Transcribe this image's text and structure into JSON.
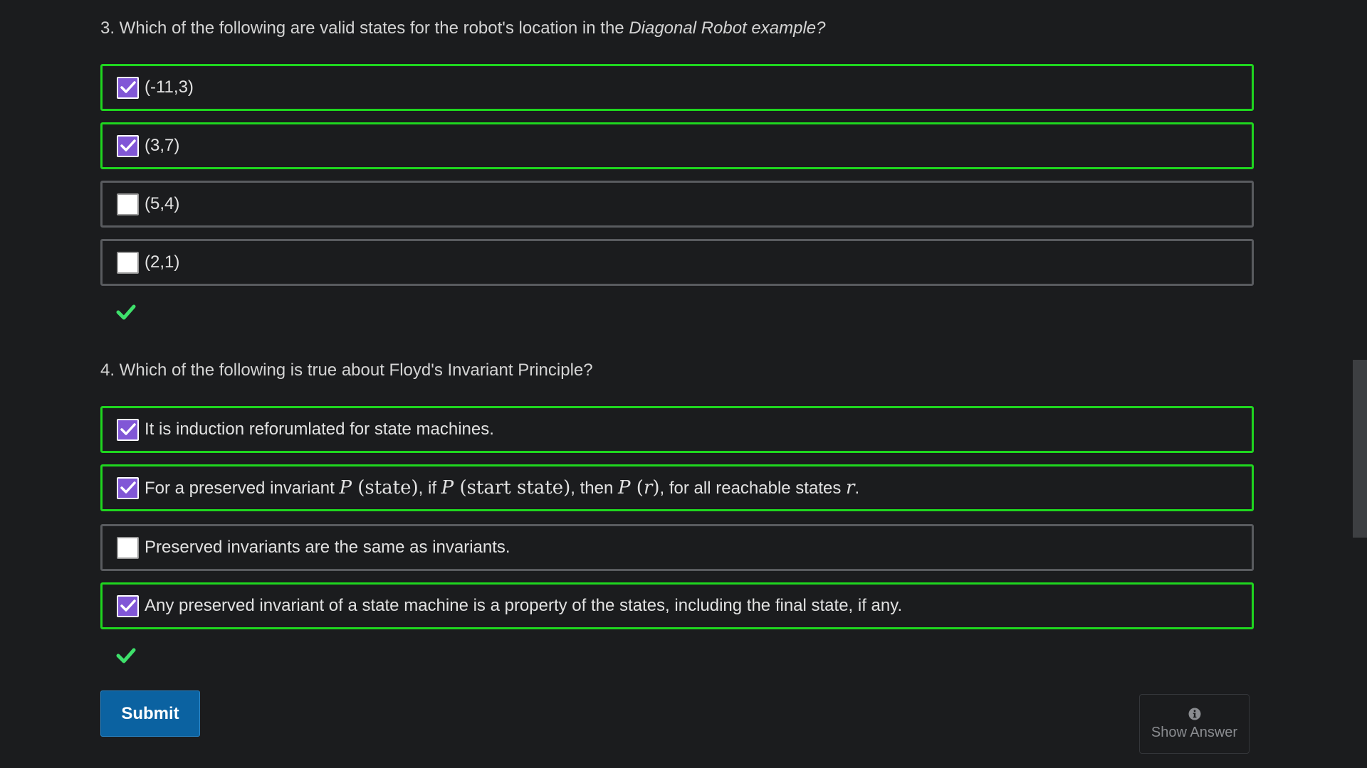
{
  "questions": [
    {
      "number_text": "3. Which of the following are valid states for the robot's location in the ",
      "italic_text": "Diagonal Robot example?",
      "options": [
        {
          "label": "(-11,3)",
          "checked": true,
          "correct": true
        },
        {
          "label": "(3,7)",
          "checked": true,
          "correct": true
        },
        {
          "label": "(5,4)",
          "checked": false,
          "correct": false
        },
        {
          "label": "(2,1)",
          "checked": false,
          "correct": false
        }
      ],
      "result": "correct"
    },
    {
      "number_text": "4. Which of the following is true about Floyd's Invariant Principle?",
      "options": [
        {
          "label": "It is induction reforumlated for state machines.",
          "checked": true,
          "correct": true
        },
        {
          "label_parts": {
            "t1": "For a preserved invariant ",
            "m1_var": "P",
            "m1_arg": "(state)",
            "t2": ", if ",
            "m2_var": "P",
            "m2_arg": "(start state)",
            "t3": ", then ",
            "m3_var": "P",
            "m3_arg_open": "(",
            "m3_arg_var": "r",
            "m3_arg_close": ")",
            "t4": ", for all reachable states ",
            "m4_var": "r",
            "t5": "."
          },
          "checked": true,
          "correct": true
        },
        {
          "label": "Preserved invariants are the same as invariants.",
          "checked": false,
          "correct": false
        },
        {
          "label": "Any preserved invariant of a state machine is a property of the states, including the final state, if any.",
          "checked": true,
          "correct": true
        }
      ],
      "result": "correct"
    }
  ],
  "buttons": {
    "submit_label": "Submit",
    "show_answer_label": "Show Answer"
  },
  "icons": {
    "checkbox_checked": "checkmark-icon",
    "result": "green-checkmark-icon",
    "info": "info-circle-icon"
  },
  "colors": {
    "background": "#1b1c1e",
    "correct_border": "#1fd61f",
    "neutral_border": "#595b5f",
    "checkbox_fill": "#8157d6",
    "submit_bg": "#0b62a1",
    "result_check": "#3ee06b"
  }
}
